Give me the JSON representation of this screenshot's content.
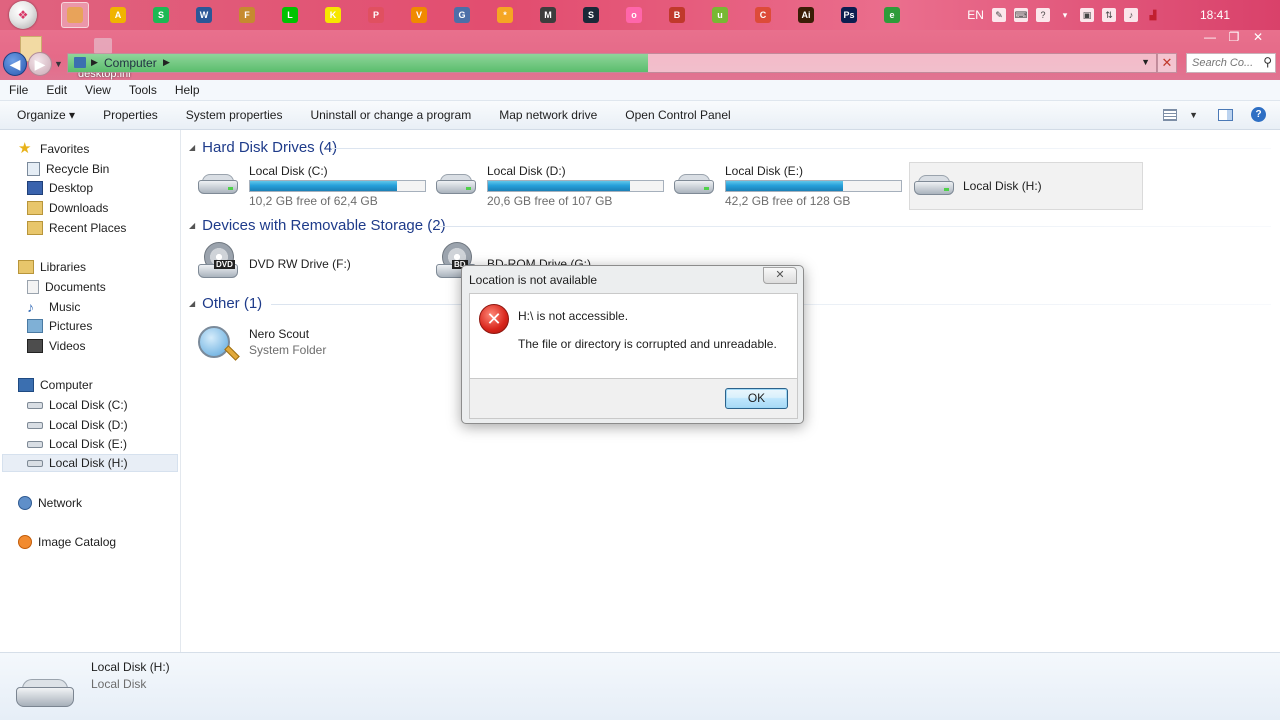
{
  "taskbar": {
    "apps": [
      {
        "name": "explorer-app-icon",
        "color": "#e8a35a",
        "glyph": "",
        "active": true
      },
      {
        "name": "app-triangle-icon",
        "color": "#f0b400",
        "glyph": "A"
      },
      {
        "name": "spotify-icon",
        "color": "#1db954",
        "glyph": "S"
      },
      {
        "name": "word-icon",
        "color": "#2b5797",
        "glyph": "W"
      },
      {
        "name": "app-feather-icon",
        "color": "#c68a2f",
        "glyph": "F"
      },
      {
        "name": "line-icon",
        "color": "#00c300",
        "glyph": "L"
      },
      {
        "name": "kakaotalk-icon",
        "color": "#f7e600",
        "glyph": "K"
      },
      {
        "name": "paint-icon",
        "color": "#e05060",
        "glyph": "P"
      },
      {
        "name": "vlc-icon",
        "color": "#f08a00",
        "glyph": "V"
      },
      {
        "name": "app-gear-icon",
        "color": "#4c6fa8",
        "glyph": "G"
      },
      {
        "name": "app-star-icon",
        "color": "#f5a623",
        "glyph": "*"
      },
      {
        "name": "media-player-icon",
        "color": "#3d3d3d",
        "glyph": "M"
      },
      {
        "name": "steam-icon",
        "color": "#1b2838",
        "glyph": "S"
      },
      {
        "name": "osu-icon",
        "color": "#ff66aa",
        "glyph": "o"
      },
      {
        "name": "app-bag-icon",
        "color": "#c0392b",
        "glyph": "B"
      },
      {
        "name": "utorrent-icon",
        "color": "#78b833",
        "glyph": "u"
      },
      {
        "name": "chrome-icon",
        "color": "#dd4b39",
        "glyph": "C"
      },
      {
        "name": "illustrator-icon",
        "color": "#3a1d06",
        "glyph": "Ai"
      },
      {
        "name": "photoshop-icon",
        "color": "#0c1e50",
        "glyph": "Ps"
      },
      {
        "name": "app-globe-icon",
        "color": "#2e9c3a",
        "glyph": "e"
      }
    ],
    "language": "EN",
    "clock": "18:41"
  },
  "window": {
    "breadcrumb": "Computer",
    "desktop_file": "desktop.ini",
    "search_placeholder": "Search Co..."
  },
  "menubar": {
    "items": [
      "File",
      "Edit",
      "View",
      "Tools",
      "Help"
    ]
  },
  "commandbar": {
    "organize": "Organize ▾",
    "properties": "Properties",
    "system_properties": "System properties",
    "uninstall": "Uninstall or change a program",
    "map_drive": "Map network drive",
    "control_panel": "Open Control Panel"
  },
  "navpane": {
    "favorites": "Favorites",
    "recycle_bin": "Recycle Bin",
    "desktop": "Desktop",
    "downloads": "Downloads",
    "recent_places": "Recent Places",
    "libraries": "Libraries",
    "documents": "Documents",
    "music": "Music",
    "pictures": "Pictures",
    "videos": "Videos",
    "computer": "Computer",
    "disk_c": "Local Disk (C:)",
    "disk_d": "Local Disk (D:)",
    "disk_e": "Local Disk (E:)",
    "disk_h": "Local Disk (H:)",
    "network": "Network",
    "image_catalog": "Image Catalog"
  },
  "content": {
    "hard_disk_header": "Hard Disk Drives (4)",
    "removable_header": "Devices with Removable Storage (2)",
    "other_header": "Other (1)",
    "drives": [
      {
        "name": "Local Disk (C:)",
        "free": "10,2 GB free of 62,4 GB",
        "used_fraction": 0.84
      },
      {
        "name": "Local Disk (D:)",
        "free": "20,6 GB free of 107 GB",
        "used_fraction": 0.81
      },
      {
        "name": "Local Disk (E:)",
        "free": "42,2 GB free of 128 GB",
        "used_fraction": 0.67
      },
      {
        "name": "Local Disk (H:)"
      }
    ],
    "dvd_drive": "DVD RW Drive (F:)",
    "dvd_label": "DVD",
    "bd_drive": "BD-ROM Drive (G:)",
    "bd_label": "BD",
    "nero_name": "Nero Scout",
    "nero_type": "System Folder"
  },
  "details": {
    "name": "Local Disk (H:)",
    "type": "Local Disk"
  },
  "dialog": {
    "title": "Location is not available",
    "message1": "H:\\ is not accessible.",
    "message2": "The file or directory is corrupted and unreadable.",
    "ok": "OK"
  }
}
